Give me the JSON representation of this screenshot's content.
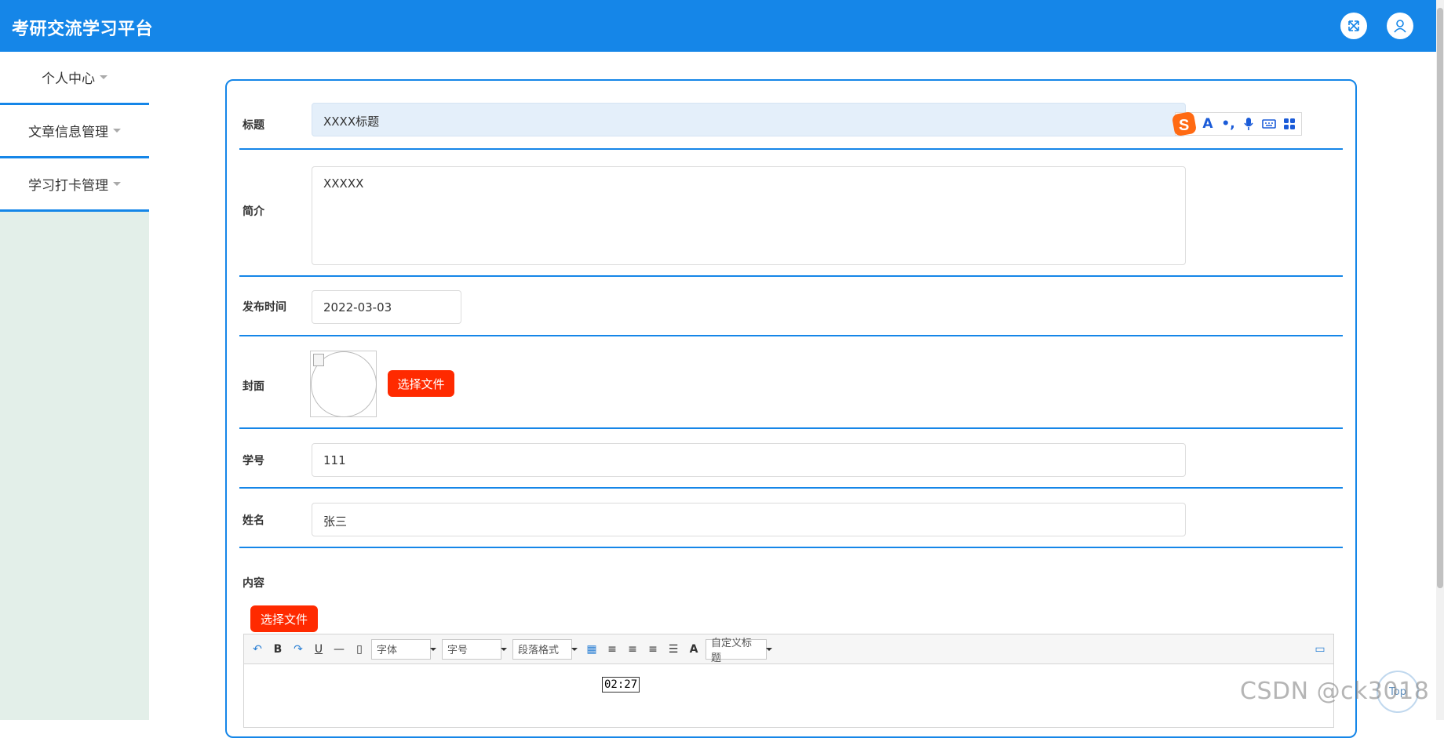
{
  "header": {
    "title": "考研交流学习平台",
    "fullscreen_icon": "expand-arrows-icon",
    "user_icon": "user-icon"
  },
  "sidebar": {
    "items": [
      {
        "label": "个人中心"
      },
      {
        "label": "文章信息管理"
      },
      {
        "label": "学习打卡管理"
      }
    ]
  },
  "form": {
    "title": {
      "label": "标题",
      "value": "XXXX标题"
    },
    "intro": {
      "label": "简介",
      "value": "XXXXX"
    },
    "publish_time": {
      "label": "发布时间",
      "value": "2022-03-03"
    },
    "cover": {
      "label": "封面",
      "button": "选择文件"
    },
    "student_id": {
      "label": "学号",
      "value": "111"
    },
    "name": {
      "label": "姓名",
      "value": "张三"
    },
    "content": {
      "label": "内容",
      "button": "选择文件"
    }
  },
  "editor_toolbar": {
    "font_family": "字体",
    "font_size": "字号",
    "paragraph": "段落格式",
    "custom_heading": "自定义标题"
  },
  "overlay": {
    "time_tooltip": "02:27",
    "top_button": "Top",
    "watermark": "CSDN @ck3018"
  },
  "colors": {
    "primary": "#1586e8",
    "danger": "#ff2a00",
    "sidebar_bg": "#e3efe9"
  }
}
